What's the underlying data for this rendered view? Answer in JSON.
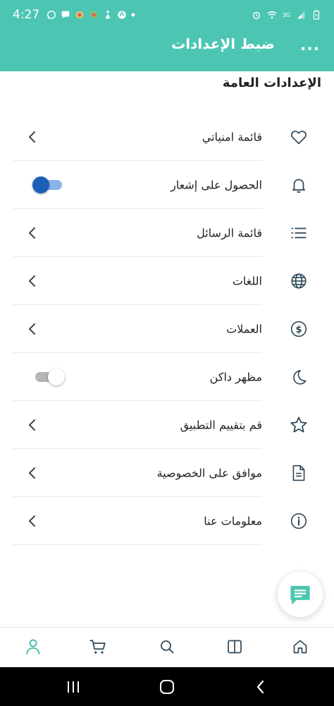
{
  "status_bar": {
    "time": "4:27",
    "left_icons": [
      "whatsapp-icon",
      "message-icon",
      "app-icon",
      "app-icon",
      "accessibility-icon",
      "app-icon",
      "dot-icon"
    ],
    "network_label": "3G",
    "right_icons": [
      "alarm-icon",
      "wifi-icon",
      "signal-icon",
      "battery-icon"
    ]
  },
  "header": {
    "title": "ضبط الإعدادات",
    "more_label": "...",
    "background": "#4cc6b2"
  },
  "section": {
    "title": "الإعدادات العامة"
  },
  "settings": {
    "items": [
      {
        "label": "قائمة امنياتي",
        "icon": "heart-icon",
        "control": "chevron"
      },
      {
        "label": "الحصول على إشعار",
        "icon": "bell-icon",
        "control": "toggle",
        "state": "on"
      },
      {
        "label": "قائمة الرسائل",
        "icon": "list-icon",
        "control": "chevron"
      },
      {
        "label": "اللغات",
        "icon": "globe-icon",
        "control": "chevron"
      },
      {
        "label": "العملات",
        "icon": "dollar-icon",
        "control": "chevron"
      },
      {
        "label": "مظهر داكن",
        "icon": "moon-icon",
        "control": "toggle",
        "state": "off"
      },
      {
        "label": "قم بتقييم التطبيق",
        "icon": "star-icon",
        "control": "chevron"
      },
      {
        "label": "موافق على الخصوصية",
        "icon": "document-icon",
        "control": "chevron"
      },
      {
        "label": "معلومات عنا",
        "icon": "info-icon",
        "control": "chevron"
      }
    ]
  },
  "fab": {
    "icon": "chat-icon"
  },
  "bottom_nav": {
    "items": [
      "profile-icon",
      "cart-icon",
      "search-icon",
      "book-icon",
      "home-icon"
    ],
    "active": "profile-icon",
    "active_color": "#3bb7a3"
  },
  "system_nav": {
    "items": [
      "recents-icon",
      "home-circle-icon",
      "back-icon"
    ]
  },
  "colors": {
    "accent": "#4cc6b2",
    "toggle_on": "#1b5fb8",
    "icon_dark": "#2f4858"
  }
}
